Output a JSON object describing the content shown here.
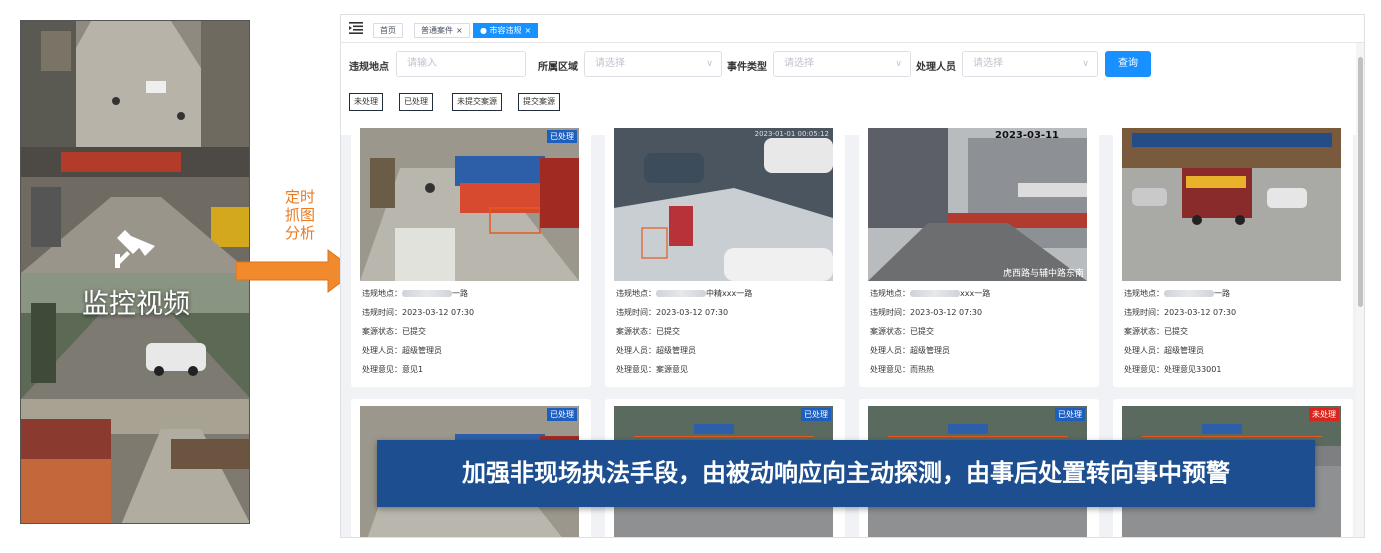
{
  "left_panel": {
    "title": "监控视频",
    "caption": [
      "定时",
      "抓图",
      "分析"
    ]
  },
  "tabs": [
    {
      "label": "首页",
      "closable": false,
      "active": false
    },
    {
      "label": "普通案件",
      "closable": true,
      "active": false
    },
    {
      "label": "市容违规",
      "closable": true,
      "active": true
    }
  ],
  "filters": {
    "location_label": "违规地点",
    "location_placeholder": "请输入",
    "area_label": "所属区域",
    "area_placeholder": "请选择",
    "event_label": "事件类型",
    "event_placeholder": "请选择",
    "handler_label": "处理人员",
    "handler_placeholder": "请选择",
    "query_label": "查询"
  },
  "status_chips": [
    "未处理",
    "已处理",
    "未提交案源",
    "提交案源"
  ],
  "field_labels": {
    "location": "违规地点：",
    "time": "违规时间：",
    "status": "案源状态：",
    "handler": "处理人员：",
    "opinion": "处理意见："
  },
  "cards": [
    {
      "badge": "已处理",
      "location_suffix": "一路",
      "time": "2023-03-12 07:30",
      "status": "已提交",
      "handler": "超级管理员",
      "opinion": "意见1"
    },
    {
      "badge": "",
      "location_suffix": "中精xxx一路",
      "time": "2023-03-12 07:30",
      "status": "已提交",
      "handler": "超级管理员",
      "opinion": "案源意见",
      "stamp": "2023-01-01 00:05:12"
    },
    {
      "badge": "",
      "location_suffix": "xxx一路",
      "time": "2023-03-12 07:30",
      "status": "已提交",
      "handler": "超级管理员",
      "opinion": "而热热",
      "stamp": "2023-03-11",
      "corner": "虎西路与辅中路东南"
    },
    {
      "badge": "",
      "location_suffix": "一路",
      "time": "2023-03-12 07:30",
      "status": "已提交",
      "handler": "超级管理员",
      "opinion": "处理意见33001"
    },
    {
      "badge": "已处理"
    },
    {
      "badge": "已处理"
    },
    {
      "badge": "已处理"
    },
    {
      "badge": "未处理"
    }
  ],
  "banner": "加强非现场执法手段，由被动响应向主动探测，由事后处置转向事中预警",
  "colors": {
    "accent": "#1890ff",
    "banner": "#1d4e8f",
    "caption": "#ea7a1f",
    "badge_done": "#1e5fbd",
    "badge_todo": "#d9261c"
  }
}
